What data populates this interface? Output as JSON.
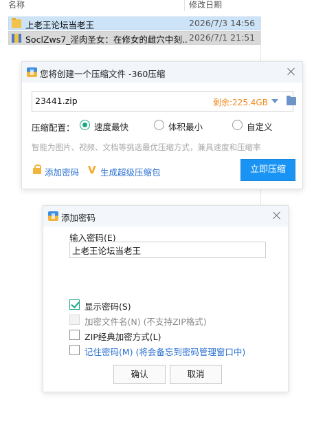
{
  "explorer": {
    "columns": {
      "name": "名称",
      "date": "修改日期"
    },
    "files": [
      {
        "name": "上老王论坛当老王",
        "date": "2026/7/3 14:56",
        "icon": "folder-icon"
      },
      {
        "name": "SoclZws7_淫肉圣女：在修女的雌穴中刻...",
        "date": "2026/7/1 21:51",
        "icon": "zip-file-icon"
      }
    ]
  },
  "compress_dialog": {
    "title": "您将创建一个压缩文件 -360压缩",
    "filename": "23441.zip",
    "free_space": "剩余:225.4GB",
    "config_label": "压缩配置：",
    "options": [
      {
        "label": "速度最快",
        "checked": true
      },
      {
        "label": "体积最小",
        "checked": false
      },
      {
        "label": "自定义",
        "checked": false
      }
    ],
    "hint": "智能为图片、视频、文档等挑选最优压缩方式，兼具速度和压缩率",
    "add_password": "添加密码",
    "super_package": "生成超级压缩包",
    "compress_button": "立即压缩",
    "accent_color": "#1a94f4"
  },
  "password_dialog": {
    "title": "添加密码",
    "enter_label": "输入密码(E)",
    "password_value": "上老王论坛当老王",
    "checkboxes": [
      {
        "label": "显示密码(S)",
        "checked": true,
        "disabled": false
      },
      {
        "label": "加密文件名(N) (不支持ZIP格式)",
        "checked": false,
        "disabled": true
      },
      {
        "label": "ZIP经典加密方式(L)",
        "checked": false,
        "disabled": false
      },
      {
        "label": "记住密码(M) (将会备忘到密码管理窗口中)",
        "checked": false,
        "disabled": false
      }
    ],
    "ok_button": "确认",
    "cancel_button": "取消"
  }
}
